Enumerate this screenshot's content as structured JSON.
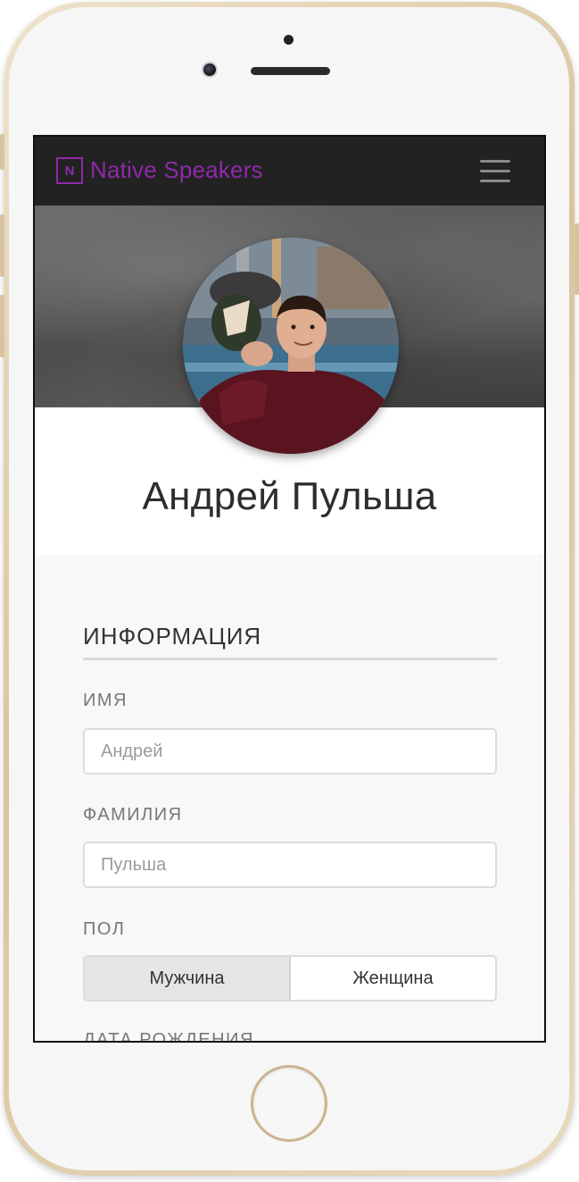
{
  "app": {
    "brand": "Native Speakers",
    "logo_letter": "N",
    "accent_color": "#8e2aa8",
    "navbar_color": "#222222"
  },
  "navbar": {
    "menu_icon": "hamburger-menu-icon"
  },
  "profile": {
    "full_name": "Андрей Пульша"
  },
  "info": {
    "section_title": "ИНФОРМАЦИЯ",
    "first_name": {
      "label": "ИМЯ",
      "placeholder": "Андрей"
    },
    "last_name": {
      "label": "ФАМИЛИЯ",
      "placeholder": "Пульша"
    },
    "gender": {
      "label": "ПОЛ",
      "options": [
        "Мужчина",
        "Женщина"
      ],
      "selected": "Мужчина"
    },
    "birth_date": {
      "label": "ДАТА РОЖДЕНИЯ"
    }
  }
}
